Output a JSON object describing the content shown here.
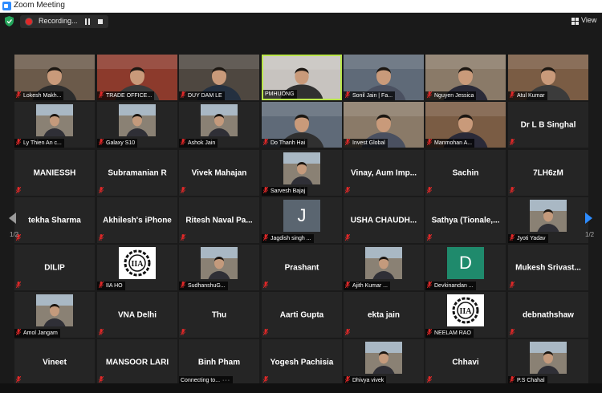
{
  "window": {
    "title": "Zoom Meeting"
  },
  "recording": {
    "label": "Recording..."
  },
  "view_button": {
    "label": "View"
  },
  "pagination": {
    "left": "1/2",
    "right": "1/2"
  },
  "colors": {
    "active_speaker": "#b9e54a",
    "rec_dot": "#e02828",
    "muted_mic": "#e02828",
    "right_arrow": "#2d8cff",
    "left_arrow": "#9a9a9a"
  },
  "rows": [
    [
      {
        "label": "Lokesh Makh...",
        "kind": "video",
        "muted": true
      },
      {
        "label": "TRADE OFFICE...",
        "kind": "video",
        "muted": true
      },
      {
        "label": "DUY DAM LE",
        "kind": "video",
        "muted": true
      },
      {
        "label": "PMHUONG",
        "kind": "video",
        "muted": false,
        "active": true
      },
      {
        "label": "Sonil Jain | Fa...",
        "kind": "video",
        "muted": true
      },
      {
        "label": "Nguyen Jessica",
        "kind": "video",
        "muted": true
      },
      {
        "label": "Atul Kumar",
        "kind": "video",
        "muted": true
      }
    ],
    [
      {
        "label": "Ly Thien An c...",
        "kind": "avatar",
        "muted": true
      },
      {
        "label": "Galaxy S10",
        "kind": "avatar",
        "muted": true
      },
      {
        "label": "Ashok Jain",
        "kind": "avatar",
        "muted": true
      },
      {
        "label": "Do Thanh Hai",
        "kind": "video",
        "muted": true
      },
      {
        "label": "Invest Global",
        "kind": "video",
        "muted": true
      },
      {
        "label": "Manmohan A...",
        "kind": "video",
        "muted": true
      },
      {
        "label": "Dr L B Singhal",
        "kind": "name",
        "muted": true
      }
    ],
    [
      {
        "label": "MANIESSH",
        "kind": "name",
        "muted": true
      },
      {
        "label": "Subramanian R",
        "kind": "name",
        "muted": true
      },
      {
        "label": "Vivek Mahajan",
        "kind": "name",
        "muted": true
      },
      {
        "label": "Sarvesh Bajaj",
        "kind": "avatar",
        "muted": true
      },
      {
        "label": "Vinay, Aum Imp...",
        "kind": "name",
        "muted": true
      },
      {
        "label": "Sachin",
        "kind": "name",
        "muted": true
      },
      {
        "label": "7LH6zM",
        "kind": "name",
        "muted": true
      }
    ],
    [
      {
        "label": "tekha Sharma",
        "kind": "name",
        "muted": true
      },
      {
        "label": "Akhilesh's iPhone",
        "kind": "name",
        "muted": true
      },
      {
        "label": "Ritesh Naval Pa...",
        "kind": "name",
        "muted": true
      },
      {
        "label": "Jagdish singh ...",
        "kind": "avatar",
        "muted": true,
        "letter": "J",
        "letter_bg": "#5a6570"
      },
      {
        "label": "USHA CHAUDH...",
        "kind": "name",
        "muted": true
      },
      {
        "label": "Sathya (Tionale,...",
        "kind": "name",
        "muted": true
      },
      {
        "label": "Jyoti Yadav",
        "kind": "avatar",
        "muted": true
      }
    ],
    [
      {
        "label": "DILIP",
        "kind": "name",
        "muted": true
      },
      {
        "label": "IIA HO",
        "kind": "avatar",
        "muted": true,
        "logo": "IIA"
      },
      {
        "label": "SudhanshuG...",
        "kind": "avatar",
        "muted": true
      },
      {
        "label": "Prashant",
        "kind": "name",
        "muted": true
      },
      {
        "label": "Ajith Kumar ...",
        "kind": "avatar",
        "muted": true
      },
      {
        "label": "Devkinandan ...",
        "kind": "avatar",
        "muted": true,
        "letter": "D",
        "letter_bg": "#1f8a6c"
      },
      {
        "label": "Mukesh Srivast...",
        "kind": "name",
        "muted": true
      }
    ],
    [
      {
        "label": "Amol Jangam",
        "kind": "avatar",
        "muted": true
      },
      {
        "label": "VNA Delhi",
        "kind": "name",
        "muted": true
      },
      {
        "label": "Thu",
        "kind": "name",
        "muted": true
      },
      {
        "label": "Aarti Gupta",
        "kind": "name",
        "muted": true
      },
      {
        "label": "ekta jain",
        "kind": "name",
        "muted": true
      },
      {
        "label": "NEELAM RAO",
        "kind": "avatar",
        "muted": true,
        "logo": "IIA"
      },
      {
        "label": "debnathshaw",
        "kind": "name",
        "muted": true
      }
    ],
    [
      {
        "label": "Vineet",
        "kind": "name",
        "muted": true
      },
      {
        "label": "MANSOOR LARI",
        "kind": "name",
        "muted": true
      },
      {
        "label": "Binh Pham",
        "kind": "name",
        "muted": false,
        "status": "Connecting to..."
      },
      {
        "label": "Yogesh Pachisia",
        "kind": "name",
        "muted": true
      },
      {
        "label": "Dhivya vivek",
        "kind": "avatar",
        "muted": true
      },
      {
        "label": "Chhavi",
        "kind": "name",
        "muted": true
      },
      {
        "label": "P.S Chahal",
        "kind": "avatar",
        "muted": true
      }
    ]
  ]
}
